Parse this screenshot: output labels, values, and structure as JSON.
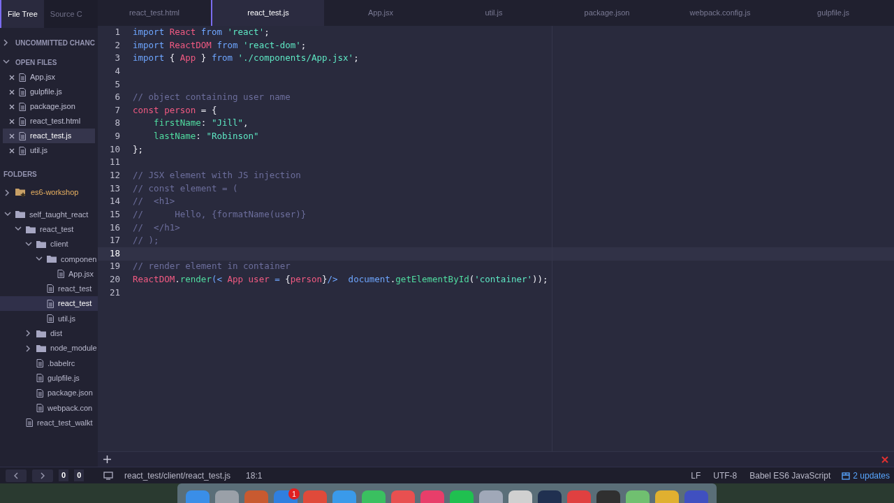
{
  "sidebar": {
    "tabs": [
      {
        "label": "File Tree",
        "selected": true
      },
      {
        "label": "Source C",
        "selected": false
      }
    ],
    "sections": [
      {
        "title": "UNCOMMITTED CHANC",
        "expanded": false
      },
      {
        "title": "OPEN FILES",
        "expanded": true
      }
    ],
    "open_files": [
      {
        "name": "App.jsx",
        "selected": false
      },
      {
        "name": "gulpfile.js",
        "selected": false
      },
      {
        "name": "package.json",
        "selected": false
      },
      {
        "name": "react_test.html",
        "selected": false
      },
      {
        "name": "react_test.js",
        "selected": true
      },
      {
        "name": "util.js",
        "selected": false
      }
    ],
    "folders_title": "FOLDERS",
    "tree": [
      {
        "kind": "repo",
        "name": "es6-workshop",
        "expanded": false,
        "selected": false
      },
      {
        "kind": "folder",
        "name": "self_taught_react",
        "expanded": true,
        "selected": false,
        "children": [
          {
            "kind": "folder",
            "name": "react_test",
            "expanded": true,
            "selected": false,
            "children": [
              {
                "kind": "folder",
                "name": "client",
                "expanded": true,
                "selected": false,
                "children": [
                  {
                    "kind": "folder",
                    "name": "componen",
                    "expanded": true,
                    "selected": false,
                    "children": [
                      {
                        "kind": "file",
                        "name": "App.jsx",
                        "selected": false
                      }
                    ]
                  },
                  {
                    "kind": "file",
                    "name": "react_test",
                    "selected": false
                  },
                  {
                    "kind": "file",
                    "name": "react_test",
                    "selected": true
                  },
                  {
                    "kind": "file",
                    "name": "util.js",
                    "selected": false
                  }
                ]
              },
              {
                "kind": "folder",
                "name": "dist",
                "expanded": false,
                "selected": false
              },
              {
                "kind": "folder",
                "name": "node_module",
                "expanded": false,
                "selected": false
              },
              {
                "kind": "file",
                "name": ".babelrc",
                "selected": false
              },
              {
                "kind": "file",
                "name": "gulpfile.js",
                "selected": false
              },
              {
                "kind": "file",
                "name": "package.json",
                "selected": false
              },
              {
                "kind": "file",
                "name": "webpack.con",
                "selected": false
              }
            ]
          },
          {
            "kind": "file",
            "name": "react_test_walkt",
            "selected": false
          }
        ]
      }
    ]
  },
  "tabs": [
    {
      "label": "react_test.html",
      "selected": false
    },
    {
      "label": "react_test.js",
      "selected": true
    },
    {
      "label": "App.jsx",
      "selected": false
    },
    {
      "label": "util.js",
      "selected": false
    },
    {
      "label": "package.json",
      "selected": false
    },
    {
      "label": "webpack.config.js",
      "selected": false
    },
    {
      "label": "gulpfile.js",
      "selected": false
    }
  ],
  "lines": [
    {
      "number": "1",
      "current": false,
      "tokens": [
        {
          "kind": "kw",
          "text": "import "
        },
        {
          "kind": "name",
          "text": "React "
        },
        {
          "kind": "kw",
          "text": "from "
        },
        {
          "kind": "str",
          "text": "'react'"
        },
        {
          "kind": "plain",
          "text": ";"
        }
      ]
    },
    {
      "number": "2",
      "current": false,
      "tokens": [
        {
          "kind": "kw",
          "text": "import "
        },
        {
          "kind": "name",
          "text": "ReactDOM "
        },
        {
          "kind": "kw",
          "text": "from "
        },
        {
          "kind": "str",
          "text": "'react-dom'"
        },
        {
          "kind": "plain",
          "text": ";"
        }
      ]
    },
    {
      "number": "3",
      "current": false,
      "tokens": [
        {
          "kind": "kw",
          "text": "import "
        },
        {
          "kind": "plain",
          "text": "{ "
        },
        {
          "kind": "name",
          "text": "App"
        },
        {
          "kind": "plain",
          "text": " } "
        },
        {
          "kind": "kw",
          "text": "from "
        },
        {
          "kind": "str",
          "text": "'./components/App.jsx'"
        },
        {
          "kind": "plain",
          "text": ";"
        }
      ]
    },
    {
      "number": "4",
      "current": false
    },
    {
      "number": "5",
      "current": false
    },
    {
      "number": "6",
      "current": false,
      "tokens": [
        {
          "kind": "comment",
          "text": "// object containing user name"
        }
      ]
    },
    {
      "number": "7",
      "current": false,
      "tokens": [
        {
          "kind": "name",
          "text": "const person"
        },
        {
          "kind": "plain",
          "text": " = {"
        }
      ]
    },
    {
      "number": "8",
      "current": false,
      "tokens": [
        {
          "kind": "prop",
          "text": "    firstName"
        },
        {
          "kind": "plain",
          "text": ": "
        },
        {
          "kind": "str",
          "text": "\"Jill\""
        },
        {
          "kind": "plain",
          "text": ","
        }
      ]
    },
    {
      "number": "9",
      "current": false,
      "tokens": [
        {
          "kind": "prop",
          "text": "    lastName"
        },
        {
          "kind": "plain",
          "text": ": "
        },
        {
          "kind": "str",
          "text": "\"Robinson\""
        }
      ]
    },
    {
      "number": "10",
      "current": false,
      "tokens": [
        {
          "kind": "plain",
          "text": "};"
        }
      ]
    },
    {
      "number": "11",
      "current": false
    },
    {
      "number": "12",
      "current": false,
      "tokens": [
        {
          "kind": "comment",
          "text": "// JSX element with JS injection"
        }
      ]
    },
    {
      "number": "13",
      "current": false,
      "tokens": [
        {
          "kind": "comment",
          "text": "// const element = ("
        }
      ]
    },
    {
      "number": "14",
      "current": false,
      "tokens": [
        {
          "kind": "comment",
          "text": "//  <h1>"
        }
      ]
    },
    {
      "number": "15",
      "current": false,
      "tokens": [
        {
          "kind": "comment",
          "text": "//      Hello, {formatName(user)}"
        }
      ]
    },
    {
      "number": "16",
      "current": false,
      "tokens": [
        {
          "kind": "comment",
          "text": "//  </h1>"
        }
      ]
    },
    {
      "number": "17",
      "current": false,
      "tokens": [
        {
          "kind": "comment",
          "text": "// );"
        }
      ]
    },
    {
      "number": "18",
      "current": true
    },
    {
      "number": "19",
      "current": false,
      "tokens": [
        {
          "kind": "comment",
          "text": "// render element in container"
        }
      ]
    },
    {
      "number": "20",
      "current": false,
      "tokens": [
        {
          "kind": "name",
          "text": "ReactDOM"
        },
        {
          "kind": "plain",
          "text": "."
        },
        {
          "kind": "prop",
          "text": "render"
        },
        {
          "kind": "kw",
          "text": "(< "
        },
        {
          "kind": "name",
          "text": "App user"
        },
        {
          "kind": "kw",
          "text": " = "
        },
        {
          "kind": "plain",
          "text": "{"
        },
        {
          "kind": "name",
          "text": "person"
        },
        {
          "kind": "plain",
          "text": "}"
        },
        {
          "kind": "kw",
          "text": "/>  document"
        },
        {
          "kind": "plain",
          "text": "."
        },
        {
          "kind": "prop",
          "text": "getElementById"
        },
        {
          "kind": "plain",
          "text": "("
        },
        {
          "kind": "str",
          "text": "'container'"
        },
        {
          "kind": "plain",
          "text": "));"
        }
      ]
    },
    {
      "number": "21",
      "current": false
    }
  ],
  "status": {
    "counts": [
      "0",
      "0"
    ],
    "path": "react_test/client/react_test.js",
    "position": "18:1",
    "line_ending": "LF",
    "encoding": "UTF-8",
    "grammar": "Babel ES6 JavaScript",
    "updates": "2 updates"
  },
  "dock": {
    "badge": "1"
  }
}
